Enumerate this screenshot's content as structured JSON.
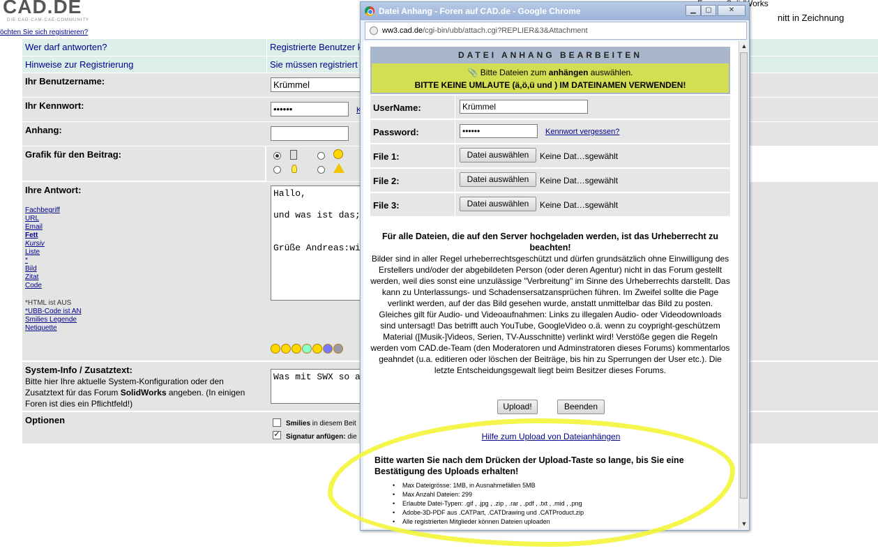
{
  "site": {
    "logo": "CAD.DE",
    "logo_sub": "DIE CAD-CAM-CAE-COMMUNITY",
    "register_link": "öchten Sie sich registrieren?",
    "forum_label": "Forum: SolidWorks",
    "topic_fragment": "nitt in Zeichnung"
  },
  "form": {
    "who_can_reply": {
      "label": "Wer darf antworten?",
      "value": "Registrierte Benutzer k"
    },
    "reg_hint": {
      "label": "Hinweise zur Registrierung",
      "value": "Sie müssen registriert"
    },
    "username": {
      "label": "Ihr Benutzername:",
      "value": "Krümmel"
    },
    "password": {
      "label": "Ihr Kennwort:",
      "value": "••••••",
      "link": "K"
    },
    "attachment": {
      "label": "Anhang:"
    },
    "graphic": {
      "label": "Grafik für den Beitrag:"
    },
    "answer": {
      "label": "Ihre Antwort:",
      "links": [
        "Fachbegriff",
        "URL",
        "Email",
        "Fett",
        "Kursiv",
        "Liste",
        "*",
        "Bild",
        "Zitat",
        "Code"
      ],
      "text_line1": "Hallo,",
      "text_line2": "und was ist das;",
      "text_line3": "Grüße Andreas:wi",
      "html_status": "*HTML ist AUS",
      "ubb_status": "*UBB-Code ist AN",
      "smilies_legend": "Smilies Legende",
      "netiquette": "Netiquette"
    },
    "sysinfo": {
      "label": "System-Info / Zusatztext:",
      "desc_pre": "Bitte hier Ihre aktuelle System-Konfiguration oder den Zusatztext für das Forum ",
      "desc_bold": "SolidWorks",
      "desc_post": " angeben. (In einigen Foren ist dies ein Pflichtfeld!)",
      "value": "Was mit SWX so a"
    },
    "options": {
      "label": "Optionen",
      "smilies_bold": "Smilies",
      "smilies_rest": " in diesem Beit",
      "signature_bold": "Signatur anfügen:",
      "signature_rest": " die"
    }
  },
  "popup": {
    "title": "Datei Anhang - Foren auf CAD.de - Google Chrome",
    "url_domain": "ww3.cad.de",
    "url_path": "/cgi-bin/ubb/attach.cgi?REPLIER&3&Attachment",
    "header": "DATEI ANHANG BEARBEITEN",
    "line1_pre": "Bitte Dateien zum ",
    "line1_bold": "anhängen",
    "line1_post": " auswählen.",
    "line2": "BITTE KEINE UMLAUTE (ä,ö,ü und ) IM DATEINAMEN VERWENDEN!",
    "username_label": "UserName:",
    "username_value": "Krümmel",
    "password_label": "Password:",
    "password_value": "••••••",
    "forgot_link": "Kennwort vergessen?",
    "files": [
      {
        "label": "File 1:",
        "button": "Datei auswählen",
        "status": "Keine Dat…sgewählt"
      },
      {
        "label": "File 2:",
        "button": "Datei auswählen",
        "status": "Keine Dat…sgewählt"
      },
      {
        "label": "File 3:",
        "button": "Datei auswählen",
        "status": "Keine Dat…sgewählt"
      }
    ],
    "notice_title": "Für alle Dateien, die auf den Server hochgeladen werden, ist das Urheberrecht zu beachten!",
    "notice_body": "Bilder sind in aller Regel urheberrechtsgeschützt und dürfen grundsätzlich ohne Einwilligung des Erstellers und/oder der abgebildeten Person (oder deren Agentur) nicht in das Forum gestellt werden, weil dies sonst eine unzulässige \"Verbreitung\" im Sinne des Urheberrechts darstellt. Das kann zu Unterlassungs- und Schadensersatzansprüchen führen. Im Zweifel sollte die Page verlinkt werden, auf der das Bild gesehen wurde, anstatt unmittelbar das Bild zu posten. Gleiches gilt für Audio- und Videoaufnahmen: Links zu illegalen Audio- oder Videodownloads sind untersagt! Das betrifft auch YouTube, GoogleVideo o.ä. wenn zu coypright-geschützem Material ([Musik-]Videos, Serien, TV-Ausschnitte) verlinkt wird! Verstöße gegen die Regeln werden vom CAD.de-Team (den Moderatoren und Adminstratoren dieses Forums) kommentarlos geahndet (u.a. editieren oder löschen der Beiträge, bis hin zu Sperrungen der User etc.). Die letzte Entscheidungsgewalt liegt beim Besitzer dieses Forums.",
    "upload_button": "Upload!",
    "close_button": "Beenden",
    "help_link": "Hilfe zum Upload von Dateianhängen",
    "wait_text": "Bitte warten Sie nach dem Drücken der Upload-Taste so lange, bis Sie eine Bestätigung des Uploads erhalten!",
    "limits": [
      "Max Dateigrösse: 1MB, in Ausnahmefällen 5MB",
      "Max Anzahl Dateien: 299",
      "Erlaubte Datei-Typen: .gif , .jpg , .zip , .rar , .pdf , .txt , .mid , .png",
      "Adobe-3D-PDF aus .CATPart, .CATDrawing und .CATProduct.zip",
      "Alle registrierten Mitglieder können Dateien uploaden"
    ]
  },
  "colors": {
    "teal_row": "#dcefe9",
    "grey_row": "#e4e4e4",
    "highlight_yellow": "#f3f538",
    "link": "#00008b"
  }
}
